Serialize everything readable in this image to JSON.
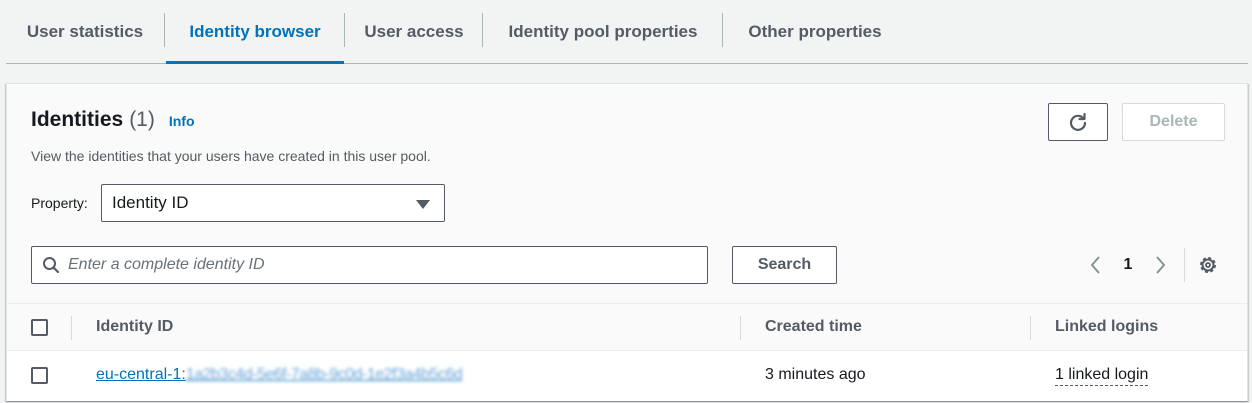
{
  "tabs": [
    {
      "label": "User statistics",
      "active": false
    },
    {
      "label": "Identity browser",
      "active": true
    },
    {
      "label": "User access",
      "active": false
    },
    {
      "label": "Identity pool properties",
      "active": false
    },
    {
      "label": "Other properties",
      "active": false
    }
  ],
  "panel": {
    "title": "Identities",
    "count": "(1)",
    "info_link": "Info",
    "description": "View the identities that your users have created in this user pool.",
    "delete_label": "Delete",
    "refresh_icon": "refresh-icon"
  },
  "filter": {
    "property_label": "Property:",
    "property_value": "Identity ID",
    "search_placeholder": "Enter a complete identity ID",
    "search_button": "Search"
  },
  "pagination": {
    "current_page": "1"
  },
  "table": {
    "columns": [
      "Identity ID",
      "Created time",
      "Linked logins"
    ],
    "rows": [
      {
        "identity_id_prefix": "eu-central-1:",
        "identity_id_redacted": "1a2b3c4d-5e6f-7a8b-9c0d-1e2f3a4b5c6d",
        "created_time": "3 minutes ago",
        "linked_logins": "1 linked login"
      }
    ]
  },
  "colors": {
    "accent": "#0073bb",
    "text": "#16191f",
    "muted": "#545b64"
  }
}
